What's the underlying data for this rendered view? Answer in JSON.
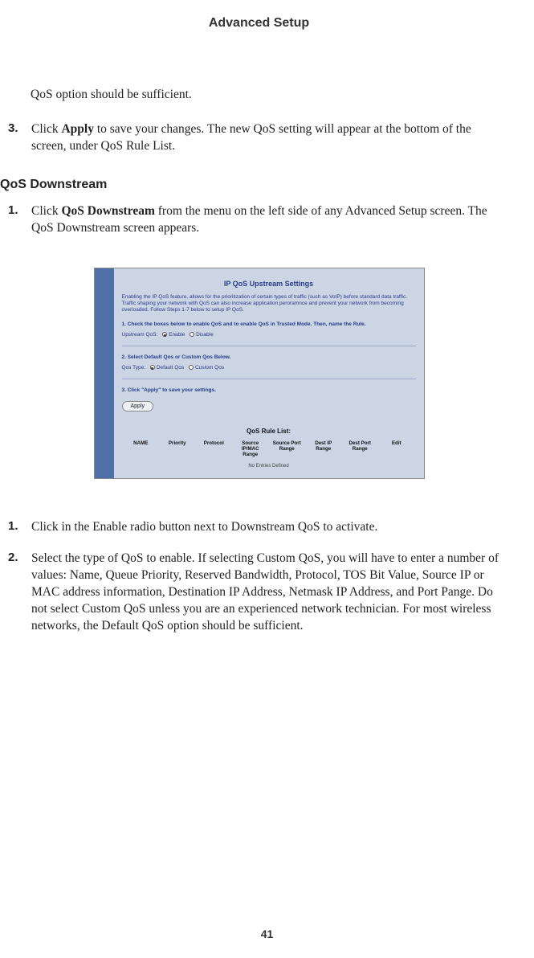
{
  "header": {
    "title": "Advanced Setup"
  },
  "intro": "QoS option should be sufficient.",
  "step3": {
    "num": "3.",
    "pre": "Click ",
    "bold": "Apply",
    "post": " to save your changes. The new QoS setting will appear at the bottom of the screen, under QoS Rule List."
  },
  "section": {
    "heading": "QoS Downstream"
  },
  "step_sec_1": {
    "num": "1.",
    "pre": "Click ",
    "bold": "QoS Downstream",
    "post": " from the menu on the left side of any Advanced Setup screen. The QoS Downstream screen appears."
  },
  "ui": {
    "title": "IP QoS Upstream Settings",
    "desc": "Enabling the IP QoS feature, allows for the prioritization of certain types of traffic (such as VoIP) before standard data traffic. Traffic shaping your network with QoS can also increase application peroramnce and prevent your network from becoming overloaded. Follow Steps 1-7 below to setup IP QoS.",
    "step1": "1. Check the boxes below to enable QoS and to enable QoS in Trusted Mode. Then, name the Rule.",
    "upstream_label": "Upstream QoS:",
    "enable": "Enable",
    "disable": "Disable",
    "step2": "2. Select Default Qos or Custom Qos Below.",
    "qostype_label": "Qos Type:",
    "default": "Default Qos",
    "custom": "Custom Qos",
    "step3": "3. Click \"Apply\" to save your settings.",
    "apply": "Apply",
    "rule_title": "QoS Rule List:",
    "cols": {
      "c1": "NAME",
      "c2": "Priority",
      "c3": "Protocol",
      "c4": "Source IP/MAC Range",
      "c5": "Source Port Range",
      "c6": "Dest IP Range",
      "c7": "Dest Port Range",
      "c8": "Edit"
    },
    "noentries": "No Entries Defined"
  },
  "lower1": {
    "num": "1.",
    "txt": "Click in the Enable radio button next to Downstream QoS to activate."
  },
  "lower2": {
    "num": "2.",
    "txt": "Select the type of QoS to enable. If selecting Custom QoS, you will have to enter a number of values: Name, Queue Priority, Reserved Bandwidth, Protocol, TOS Bit Value, Source IP or MAC address information, Destination IP Address, Netmask IP Address, and Port Pange. Do not select Custom QoS unless you are an experienced network technician. For most wireless networks, the Default QoS option should be sufficient."
  },
  "page": "41"
}
